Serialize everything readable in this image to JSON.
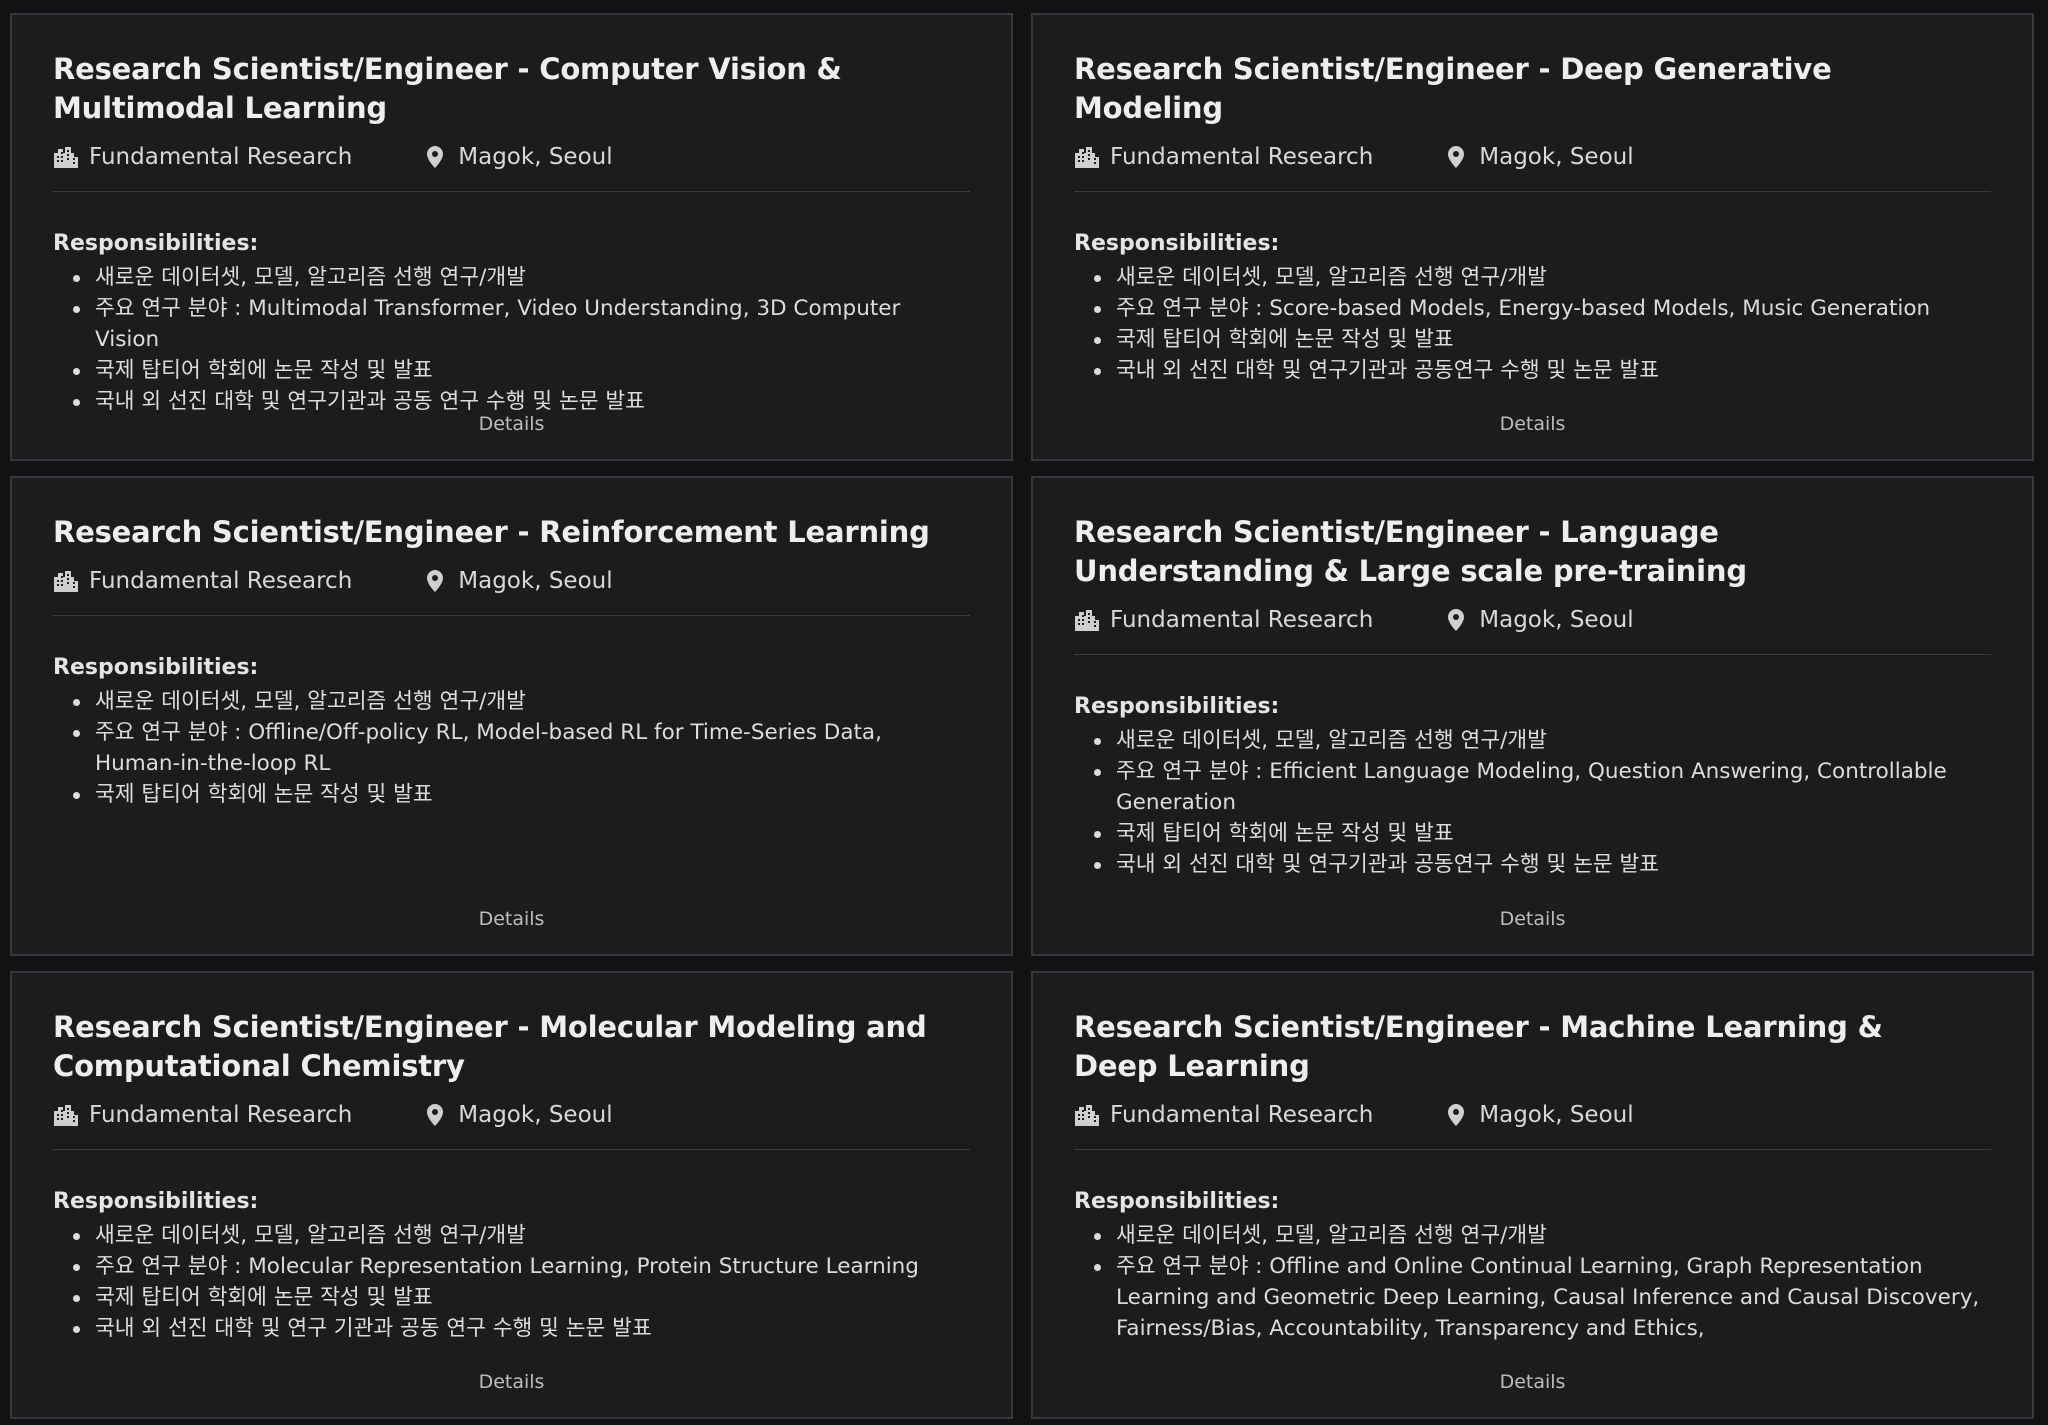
{
  "jobs": [
    {
      "title": "Research Scientist/Engineer - Computer Vision & Multimodal Learning",
      "department": "Fundamental Research",
      "location": "Magok, Seoul",
      "responsibilities_label": "Responsibilities:",
      "responsibilities": [
        "새로운 데이터셋, 모델, 알고리즘 선행 연구/개발",
        "주요 연구 분야 : Multimodal Transformer, Video Understanding, 3D Computer Vision",
        "국제 탑티어 학회에 논문 작성 및 발표",
        "국내 외 선진 대학 및 연구기관과 공동 연구 수행 및 논문 발표"
      ],
      "details_label": "Details"
    },
    {
      "title": "Research Scientist/Engineer - Deep Generative Modeling",
      "department": "Fundamental Research",
      "location": "Magok, Seoul",
      "responsibilities_label": "Responsibilities:",
      "responsibilities": [
        "새로운 데이터셋, 모델, 알고리즘 선행 연구/개발",
        "주요 연구 분야 : Score-based Models, Energy-based Models, Music Generation",
        "국제 탑티어 학회에 논문 작성 및 발표",
        "국내 외 선진 대학 및 연구기관과 공동연구 수행 및 논문 발표"
      ],
      "details_label": "Details"
    },
    {
      "title": "Research Scientist/Engineer - Reinforcement Learning",
      "department": "Fundamental Research",
      "location": "Magok, Seoul",
      "responsibilities_label": "Responsibilities:",
      "responsibilities": [
        "새로운 데이터셋, 모델, 알고리즘 선행 연구/개발",
        "주요 연구 분야 : Offline/Off-policy RL, Model-based RL for Time-Series Data, Human-in-the-loop RL",
        "국제 탑티어 학회에 논문 작성 및 발표"
      ],
      "details_label": "Details"
    },
    {
      "title": "Research Scientist/Engineer - Language Understanding & Large scale pre-training",
      "department": "Fundamental Research",
      "location": "Magok, Seoul",
      "responsibilities_label": "Responsibilities:",
      "responsibilities": [
        "새로운 데이터셋, 모델, 알고리즘 선행 연구/개발",
        "주요 연구 분야 : Efficient Language Modeling, Question Answering, Controllable Generation",
        "국제 탑티어 학회에 논문 작성 및 발표",
        "국내 외 선진 대학 및 연구기관과 공동연구 수행 및 논문 발표"
      ],
      "details_label": "Details"
    },
    {
      "title": "Research Scientist/Engineer - Molecular Modeling and Computational Chemistry",
      "department": "Fundamental Research",
      "location": "Magok, Seoul",
      "responsibilities_label": "Responsibilities:",
      "responsibilities": [
        "새로운 데이터셋, 모델, 알고리즘 선행 연구/개발",
        "주요 연구 분야 : Molecular Representation Learning, Protein Structure Learning",
        "국제 탑티어 학회에 논문 작성 및 발표",
        "국내 외 선진 대학 및 연구 기관과 공동 연구 수행 및 논문 발표"
      ],
      "details_label": "Details"
    },
    {
      "title": "Research Scientist/Engineer - Machine Learning & Deep Learning",
      "department": "Fundamental Research",
      "location": "Magok, Seoul",
      "responsibilities_label": "Responsibilities:",
      "responsibilities": [
        "새로운 데이터셋, 모델, 알고리즘 선행 연구/개발",
        "주요 연구 분야 : Offline and Online Continual Learning, Graph Representation Learning and Geometric Deep Learning, Causal Inference and Causal Discovery, Fairness/Bias, Accountability, Transparency and Ethics,"
      ],
      "details_label": "Details"
    }
  ],
  "icons": {
    "department": "building-icon",
    "location": "map-pin-icon"
  }
}
